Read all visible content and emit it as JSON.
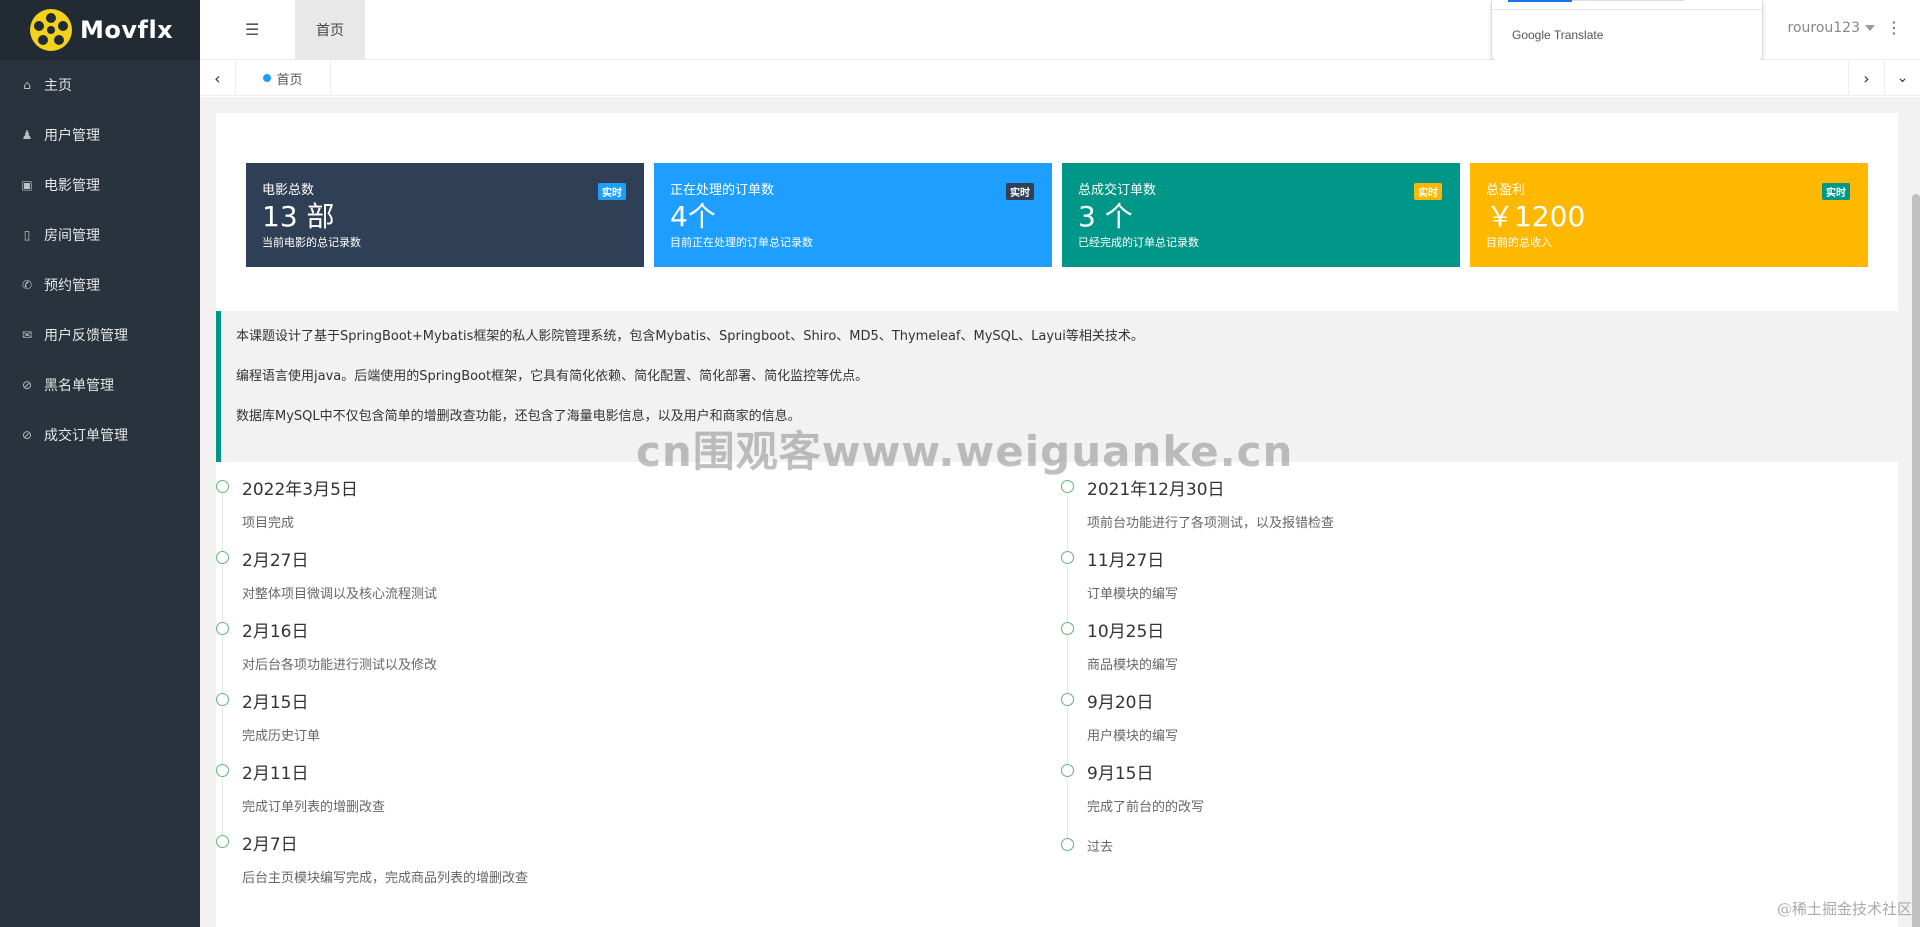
{
  "app": {
    "name": "Movflx"
  },
  "sidebar": {
    "items": [
      {
        "label": "主页",
        "icon": "home-icon"
      },
      {
        "label": "用户管理",
        "icon": "user-icon"
      },
      {
        "label": "电影管理",
        "icon": "film-icon"
      },
      {
        "label": "房间管理",
        "icon": "room-icon"
      },
      {
        "label": "预约管理",
        "icon": "phone-icon"
      },
      {
        "label": "用户反馈管理",
        "icon": "mail-icon"
      },
      {
        "label": "黑名单管理",
        "icon": "ban-icon"
      },
      {
        "label": "成交订单管理",
        "icon": "ban-icon"
      }
    ]
  },
  "header": {
    "tab": "首页",
    "user": "rourou123",
    "translate": {
      "brand": "Google",
      "label": "Translate"
    }
  },
  "tabs": {
    "current": "首页"
  },
  "cards": [
    {
      "title": "电影总数",
      "value": "13 部",
      "sub": "当前电影的总记录数",
      "badge": "实时",
      "color": "#2f4056",
      "badge_bg": "#1e9fff",
      "badge_fg": "#fff"
    },
    {
      "title": "正在处理的订单数",
      "value": "4个",
      "sub": "目前正在处理的订单总记录数",
      "badge": "实时",
      "color": "#1e9fff",
      "badge_bg": "#2f4056",
      "badge_fg": "#fff"
    },
    {
      "title": "总成交订单数",
      "value": "3 个",
      "sub": "已经完成的订单总记录数",
      "badge": "实时",
      "color": "#009688",
      "badge_bg": "#ffb800",
      "badge_fg": "#fff"
    },
    {
      "title": "总盈利",
      "value": "￥1200",
      "sub": "目前的总收入",
      "badge": "实时",
      "color": "#ffb800",
      "badge_bg": "#009688",
      "badge_fg": "#fff"
    }
  ],
  "intro": {
    "lines": [
      "本课题设计了基于SpringBoot+Mybatis框架的私人影院管理系统，包含Mybatis、Springboot、Shiro、MD5、Thymeleaf、MySQL、Layui等相关技术。",
      "编程语言使用java。后端使用的SpringBoot框架，它具有简化依赖、简化配置、简化部署、简化监控等优点。",
      "数据库MySQL中不仅包含简单的增删改查功能，还包含了海量电影信息，以及用户和商家的信息。"
    ]
  },
  "timeline_left": [
    {
      "date": "2022年3月5日",
      "desc": "项目完成"
    },
    {
      "date": "2月27日",
      "desc": "对整体项目微调以及核心流程测试"
    },
    {
      "date": "2月16日",
      "desc": "对后台各项功能进行测试以及修改"
    },
    {
      "date": "2月15日",
      "desc": "完成历史订单"
    },
    {
      "date": "2月11日",
      "desc": "完成订单列表的增删改查"
    },
    {
      "date": "2月7日",
      "desc": "后台主页模块编写完成，完成商品列表的增删改查"
    }
  ],
  "timeline_right": [
    {
      "date": "2021年12月30日",
      "desc": "项前台功能进行了各项测试，以及报错检查"
    },
    {
      "date": "11月27日",
      "desc": "订单模块的编写"
    },
    {
      "date": "10月25日",
      "desc": "商品模块的编写"
    },
    {
      "date": "9月20日",
      "desc": "用户模块的编写"
    },
    {
      "date": "9月15日",
      "desc": "完成了前台的的改写"
    },
    {
      "date": "过去",
      "desc": ""
    }
  ],
  "watermark": "cn围观客www.weiguanke.cn",
  "corner_watermark": "@稀土掘金技术社区"
}
